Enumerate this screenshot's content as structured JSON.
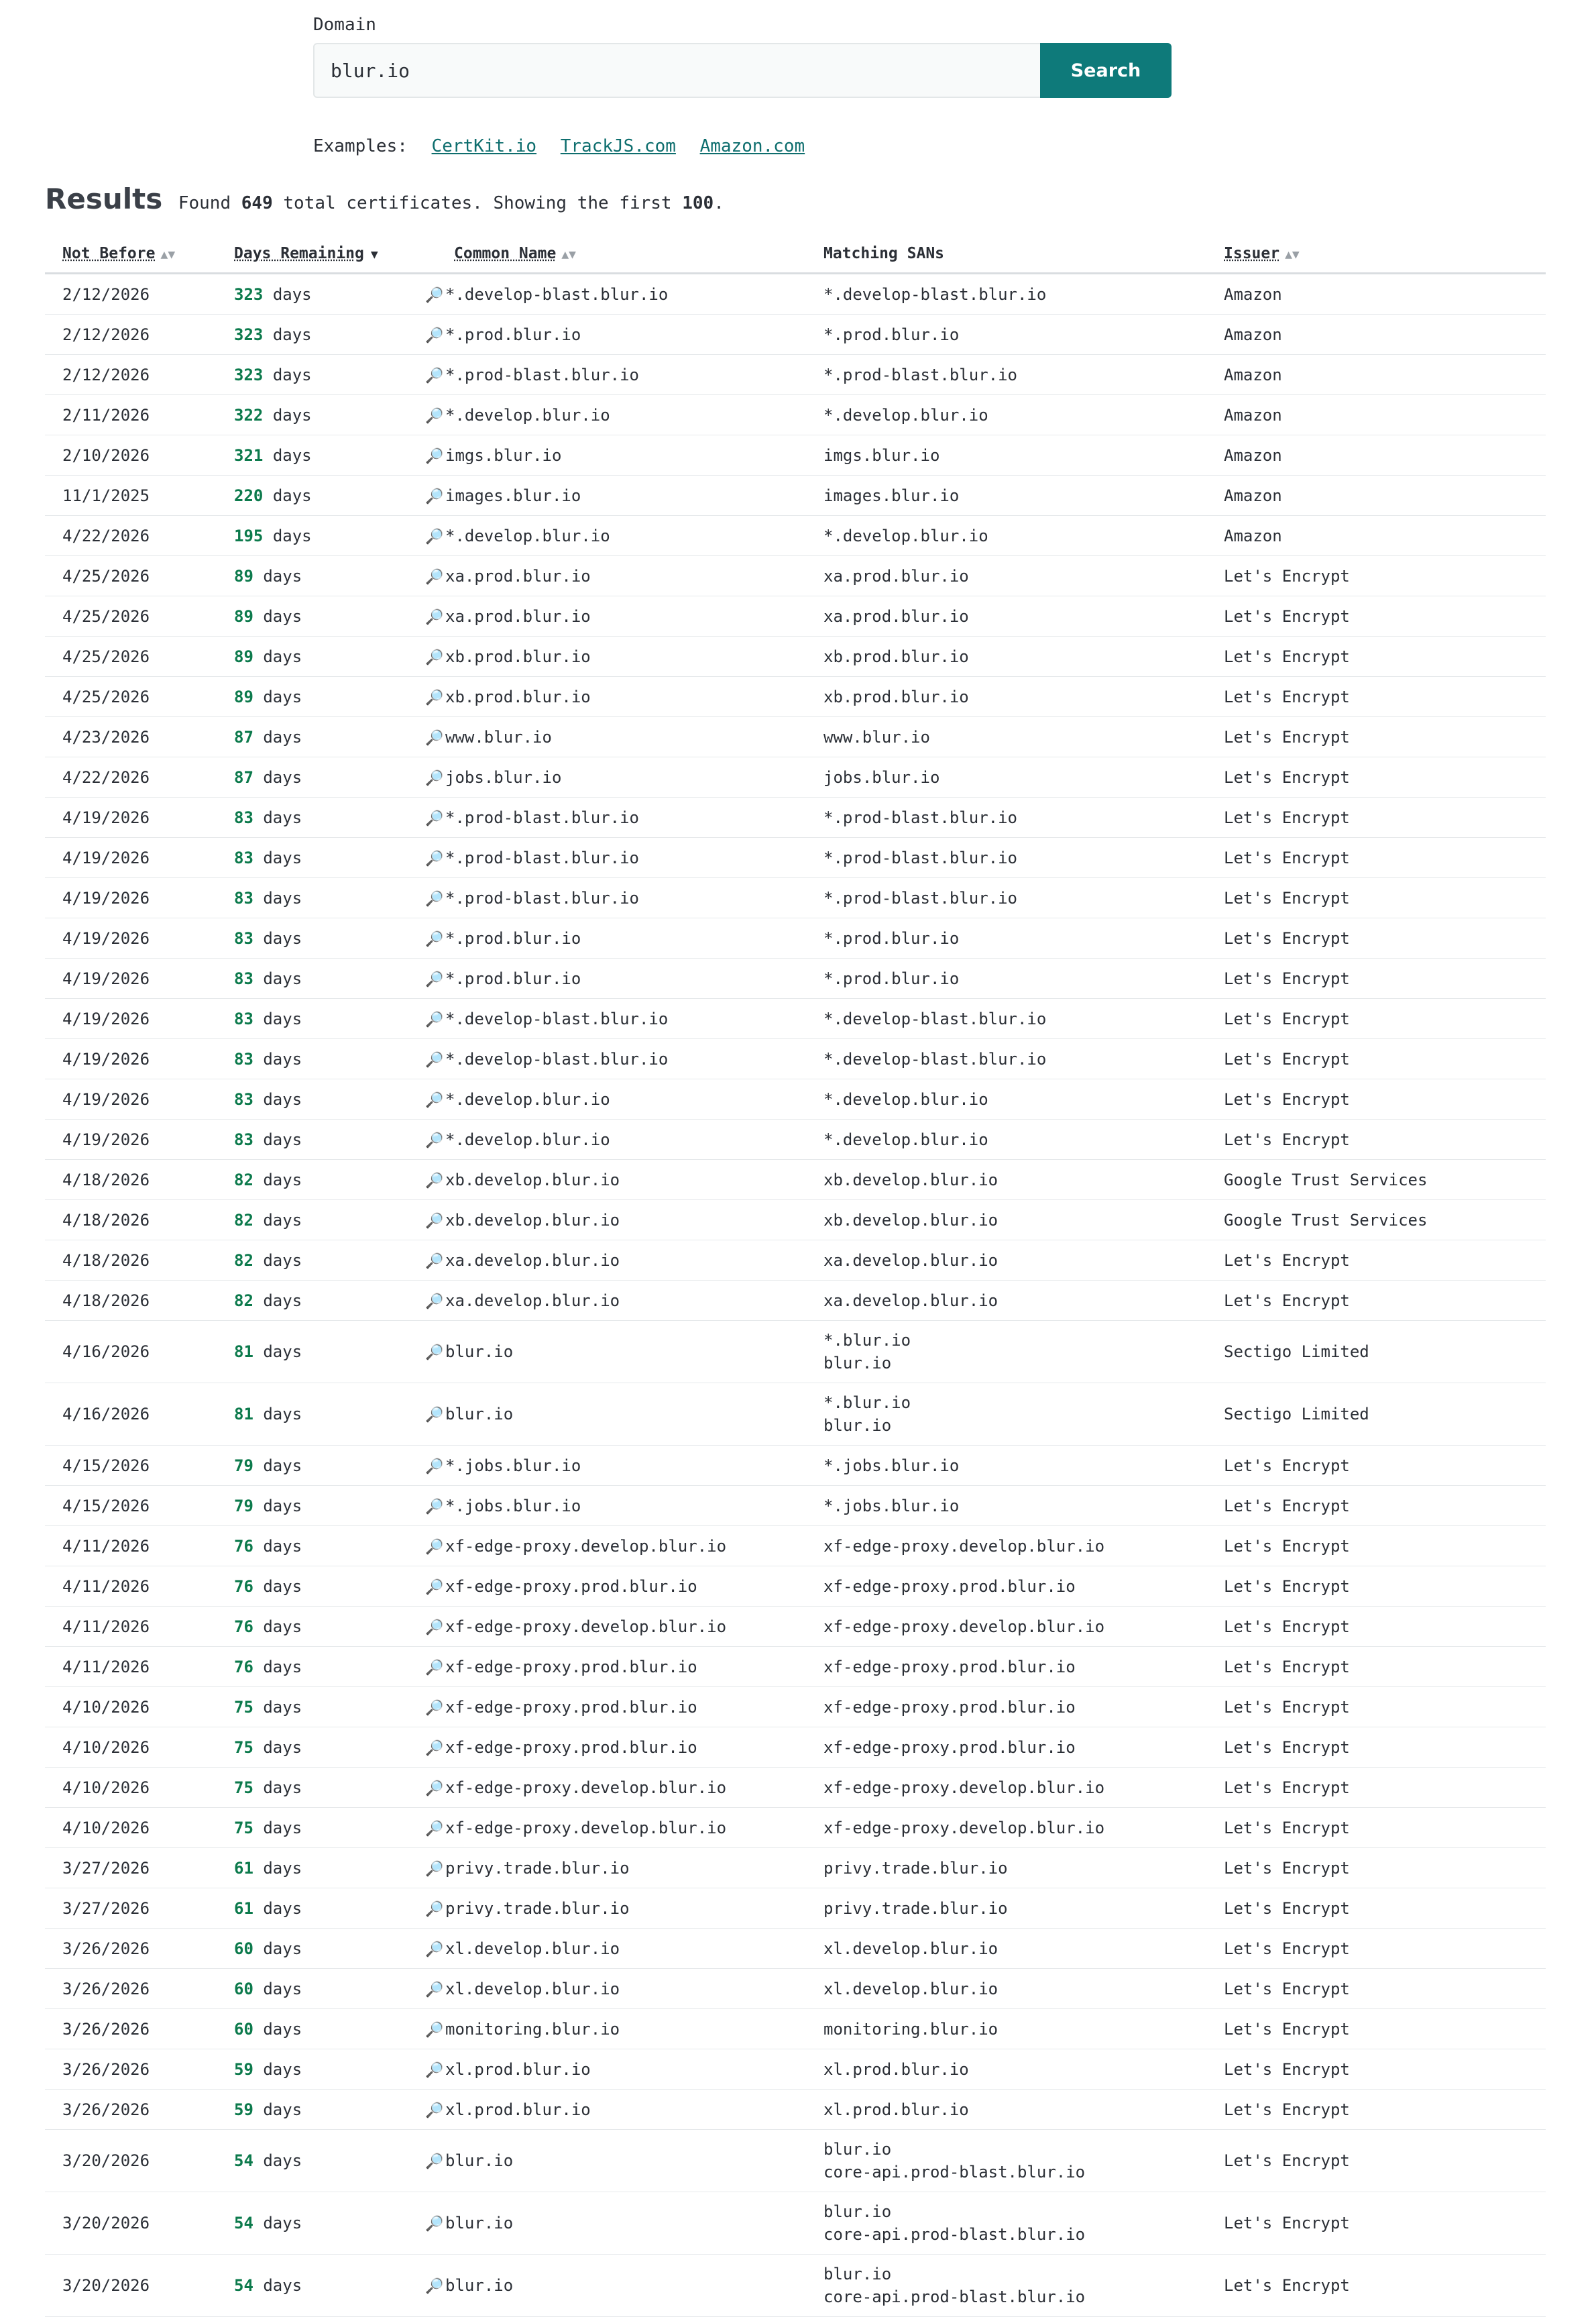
{
  "search": {
    "label": "Domain",
    "value": "blur.io",
    "button": "Search"
  },
  "examples": {
    "label": "Examples:",
    "links": [
      "CertKit.io",
      "TrackJS.com",
      "Amazon.com"
    ]
  },
  "results": {
    "title": "Results",
    "found_prefix": "Found",
    "total": "649",
    "found_middle": "total certificates. Showing the first",
    "shown": "100",
    "found_suffix": "."
  },
  "table": {
    "columns": [
      "Not Before",
      "Days Remaining",
      "Common Name",
      "Matching SANs",
      "Issuer"
    ],
    "days_unit": "days",
    "rows": [
      {
        "not_before": "2/12/2026",
        "days": "323",
        "cn": "*.develop-blast.blur.io",
        "sans": [
          "*.develop-blast.blur.io"
        ],
        "issuer": "Amazon"
      },
      {
        "not_before": "2/12/2026",
        "days": "323",
        "cn": "*.prod.blur.io",
        "sans": [
          "*.prod.blur.io"
        ],
        "issuer": "Amazon"
      },
      {
        "not_before": "2/12/2026",
        "days": "323",
        "cn": "*.prod-blast.blur.io",
        "sans": [
          "*.prod-blast.blur.io"
        ],
        "issuer": "Amazon"
      },
      {
        "not_before": "2/11/2026",
        "days": "322",
        "cn": "*.develop.blur.io",
        "sans": [
          "*.develop.blur.io"
        ],
        "issuer": "Amazon"
      },
      {
        "not_before": "2/10/2026",
        "days": "321",
        "cn": "imgs.blur.io",
        "sans": [
          "imgs.blur.io"
        ],
        "issuer": "Amazon"
      },
      {
        "not_before": "11/1/2025",
        "days": "220",
        "cn": "images.blur.io",
        "sans": [
          "images.blur.io"
        ],
        "issuer": "Amazon"
      },
      {
        "not_before": "4/22/2026",
        "days": "195",
        "cn": "*.develop.blur.io",
        "sans": [
          "*.develop.blur.io"
        ],
        "issuer": "Amazon"
      },
      {
        "not_before": "4/25/2026",
        "days": "89",
        "cn": "xa.prod.blur.io",
        "sans": [
          "xa.prod.blur.io"
        ],
        "issuer": "Let's Encrypt"
      },
      {
        "not_before": "4/25/2026",
        "days": "89",
        "cn": "xa.prod.blur.io",
        "sans": [
          "xa.prod.blur.io"
        ],
        "issuer": "Let's Encrypt"
      },
      {
        "not_before": "4/25/2026",
        "days": "89",
        "cn": "xb.prod.blur.io",
        "sans": [
          "xb.prod.blur.io"
        ],
        "issuer": "Let's Encrypt"
      },
      {
        "not_before": "4/25/2026",
        "days": "89",
        "cn": "xb.prod.blur.io",
        "sans": [
          "xb.prod.blur.io"
        ],
        "issuer": "Let's Encrypt"
      },
      {
        "not_before": "4/23/2026",
        "days": "87",
        "cn": "www.blur.io",
        "sans": [
          "www.blur.io"
        ],
        "issuer": "Let's Encrypt"
      },
      {
        "not_before": "4/22/2026",
        "days": "87",
        "cn": "jobs.blur.io",
        "sans": [
          "jobs.blur.io"
        ],
        "issuer": "Let's Encrypt"
      },
      {
        "not_before": "4/19/2026",
        "days": "83",
        "cn": "*.prod-blast.blur.io",
        "sans": [
          "*.prod-blast.blur.io"
        ],
        "issuer": "Let's Encrypt"
      },
      {
        "not_before": "4/19/2026",
        "days": "83",
        "cn": "*.prod-blast.blur.io",
        "sans": [
          "*.prod-blast.blur.io"
        ],
        "issuer": "Let's Encrypt"
      },
      {
        "not_before": "4/19/2026",
        "days": "83",
        "cn": "*.prod-blast.blur.io",
        "sans": [
          "*.prod-blast.blur.io"
        ],
        "issuer": "Let's Encrypt"
      },
      {
        "not_before": "4/19/2026",
        "days": "83",
        "cn": "*.prod.blur.io",
        "sans": [
          "*.prod.blur.io"
        ],
        "issuer": "Let's Encrypt"
      },
      {
        "not_before": "4/19/2026",
        "days": "83",
        "cn": "*.prod.blur.io",
        "sans": [
          "*.prod.blur.io"
        ],
        "issuer": "Let's Encrypt"
      },
      {
        "not_before": "4/19/2026",
        "days": "83",
        "cn": "*.develop-blast.blur.io",
        "sans": [
          "*.develop-blast.blur.io"
        ],
        "issuer": "Let's Encrypt"
      },
      {
        "not_before": "4/19/2026",
        "days": "83",
        "cn": "*.develop-blast.blur.io",
        "sans": [
          "*.develop-blast.blur.io"
        ],
        "issuer": "Let's Encrypt"
      },
      {
        "not_before": "4/19/2026",
        "days": "83",
        "cn": "*.develop.blur.io",
        "sans": [
          "*.develop.blur.io"
        ],
        "issuer": "Let's Encrypt"
      },
      {
        "not_before": "4/19/2026",
        "days": "83",
        "cn": "*.develop.blur.io",
        "sans": [
          "*.develop.blur.io"
        ],
        "issuer": "Let's Encrypt"
      },
      {
        "not_before": "4/18/2026",
        "days": "82",
        "cn": "xb.develop.blur.io",
        "sans": [
          "xb.develop.blur.io"
        ],
        "issuer": "Google Trust Services"
      },
      {
        "not_before": "4/18/2026",
        "days": "82",
        "cn": "xb.develop.blur.io",
        "sans": [
          "xb.develop.blur.io"
        ],
        "issuer": "Google Trust Services"
      },
      {
        "not_before": "4/18/2026",
        "days": "82",
        "cn": "xa.develop.blur.io",
        "sans": [
          "xa.develop.blur.io"
        ],
        "issuer": "Let's Encrypt"
      },
      {
        "not_before": "4/18/2026",
        "days": "82",
        "cn": "xa.develop.blur.io",
        "sans": [
          "xa.develop.blur.io"
        ],
        "issuer": "Let's Encrypt"
      },
      {
        "not_before": "4/16/2026",
        "days": "81",
        "cn": "blur.io",
        "sans": [
          "*.blur.io",
          "blur.io"
        ],
        "issuer": "Sectigo Limited"
      },
      {
        "not_before": "4/16/2026",
        "days": "81",
        "cn": "blur.io",
        "sans": [
          "*.blur.io",
          "blur.io"
        ],
        "issuer": "Sectigo Limited"
      },
      {
        "not_before": "4/15/2026",
        "days": "79",
        "cn": "*.jobs.blur.io",
        "sans": [
          "*.jobs.blur.io"
        ],
        "issuer": "Let's Encrypt"
      },
      {
        "not_before": "4/15/2026",
        "days": "79",
        "cn": "*.jobs.blur.io",
        "sans": [
          "*.jobs.blur.io"
        ],
        "issuer": "Let's Encrypt"
      },
      {
        "not_before": "4/11/2026",
        "days": "76",
        "cn": "xf-edge-proxy.develop.blur.io",
        "sans": [
          "xf-edge-proxy.develop.blur.io"
        ],
        "issuer": "Let's Encrypt"
      },
      {
        "not_before": "4/11/2026",
        "days": "76",
        "cn": "xf-edge-proxy.prod.blur.io",
        "sans": [
          "xf-edge-proxy.prod.blur.io"
        ],
        "issuer": "Let's Encrypt"
      },
      {
        "not_before": "4/11/2026",
        "days": "76",
        "cn": "xf-edge-proxy.develop.blur.io",
        "sans": [
          "xf-edge-proxy.develop.blur.io"
        ],
        "issuer": "Let's Encrypt"
      },
      {
        "not_before": "4/11/2026",
        "days": "76",
        "cn": "xf-edge-proxy.prod.blur.io",
        "sans": [
          "xf-edge-proxy.prod.blur.io"
        ],
        "issuer": "Let's Encrypt"
      },
      {
        "not_before": "4/10/2026",
        "days": "75",
        "cn": "xf-edge-proxy.prod.blur.io",
        "sans": [
          "xf-edge-proxy.prod.blur.io"
        ],
        "issuer": "Let's Encrypt"
      },
      {
        "not_before": "4/10/2026",
        "days": "75",
        "cn": "xf-edge-proxy.prod.blur.io",
        "sans": [
          "xf-edge-proxy.prod.blur.io"
        ],
        "issuer": "Let's Encrypt"
      },
      {
        "not_before": "4/10/2026",
        "days": "75",
        "cn": "xf-edge-proxy.develop.blur.io",
        "sans": [
          "xf-edge-proxy.develop.blur.io"
        ],
        "issuer": "Let's Encrypt"
      },
      {
        "not_before": "4/10/2026",
        "days": "75",
        "cn": "xf-edge-proxy.develop.blur.io",
        "sans": [
          "xf-edge-proxy.develop.blur.io"
        ],
        "issuer": "Let's Encrypt"
      },
      {
        "not_before": "3/27/2026",
        "days": "61",
        "cn": "privy.trade.blur.io",
        "sans": [
          "privy.trade.blur.io"
        ],
        "issuer": "Let's Encrypt"
      },
      {
        "not_before": "3/27/2026",
        "days": "61",
        "cn": "privy.trade.blur.io",
        "sans": [
          "privy.trade.blur.io"
        ],
        "issuer": "Let's Encrypt"
      },
      {
        "not_before": "3/26/2026",
        "days": "60",
        "cn": "xl.develop.blur.io",
        "sans": [
          "xl.develop.blur.io"
        ],
        "issuer": "Let's Encrypt"
      },
      {
        "not_before": "3/26/2026",
        "days": "60",
        "cn": "xl.develop.blur.io",
        "sans": [
          "xl.develop.blur.io"
        ],
        "issuer": "Let's Encrypt"
      },
      {
        "not_before": "3/26/2026",
        "days": "60",
        "cn": "monitoring.blur.io",
        "sans": [
          "monitoring.blur.io"
        ],
        "issuer": "Let's Encrypt"
      },
      {
        "not_before": "3/26/2026",
        "days": "59",
        "cn": "xl.prod.blur.io",
        "sans": [
          "xl.prod.blur.io"
        ],
        "issuer": "Let's Encrypt"
      },
      {
        "not_before": "3/26/2026",
        "days": "59",
        "cn": "xl.prod.blur.io",
        "sans": [
          "xl.prod.blur.io"
        ],
        "issuer": "Let's Encrypt"
      },
      {
        "not_before": "3/20/2026",
        "days": "54",
        "cn": "blur.io",
        "sans": [
          "blur.io",
          "core-api.prod-blast.blur.io"
        ],
        "issuer": "Let's Encrypt"
      },
      {
        "not_before": "3/20/2026",
        "days": "54",
        "cn": "blur.io",
        "sans": [
          "blur.io",
          "core-api.prod-blast.blur.io"
        ],
        "issuer": "Let's Encrypt"
      },
      {
        "not_before": "3/20/2026",
        "days": "54",
        "cn": "blur.io",
        "sans": [
          "blur.io",
          "core-api.prod-blast.blur.io"
        ],
        "issuer": "Let's Encrypt"
      }
    ]
  }
}
